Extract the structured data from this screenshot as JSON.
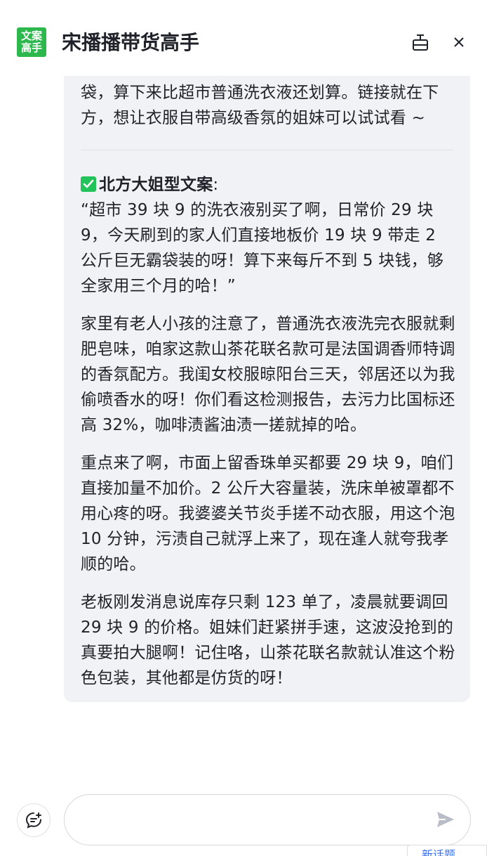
{
  "header": {
    "logo_line1": "文案",
    "logo_line2": "高手",
    "title": "宋播播带货高手",
    "pin_icon": "pin-icon",
    "close_icon": "close-icon"
  },
  "message": {
    "top_text": "袋，算下来比超市普通洗衣液还划算。链接就在下方，想让衣服自带高级香氛的姐妹可以试试看 ~",
    "section_title": "北方大姐型文案",
    "section_colon": ":",
    "quote": "“超市 39 块 9 的洗衣液别买了啊，日常价 29 块 9，今天刷到的家人们直接地板价 19 块 9 带走 2 公斤巨无霸袋装的呀！算下来每斤不到 5 块钱，够全家用三个月的哈！”",
    "para3": "家里有老人小孩的注意了，普通洗衣液洗完衣服就剩肥皂味，咱家这款山茶花联名款可是法国调香师特调的香氛配方。我闺女校服晾阳台三天，邻居还以为我偷喷香水的呀！你们看这检测报告，去污力比国标还高 32%，咖啡渍酱油渍一搓就掉的哈。",
    "para4": "重点来了啊，市面上留香珠单买都要 29 块 9，咱们直接加量不加价。2 公斤大容量装，洗床单被罩都不用心疼的呀。我婆婆关节炎手搓不动衣服，用这个泡 10 分钟，污渍自己就浮上来了，现在逢人就夸我孝顺的哈。",
    "para5": "老板刚发消息说库存只剩 123 单了，凌晨就要调回 29 块 9 的价格。姐妹们赶紧拼手速，这波没抢到的真要拍大腿啊！记住咯，山茶花联名款就认准这个粉色包装，其他都是仿货的呀！"
  },
  "footer": {
    "input_value": "",
    "new_chat_icon": "new-chat-icon",
    "send_icon": "send-icon",
    "float_tab_label": "新话题"
  },
  "colors": {
    "brand": "#2db84d",
    "bubble_bg": "#f1f2f6",
    "check": "#23c35c",
    "link": "#3370ff"
  }
}
